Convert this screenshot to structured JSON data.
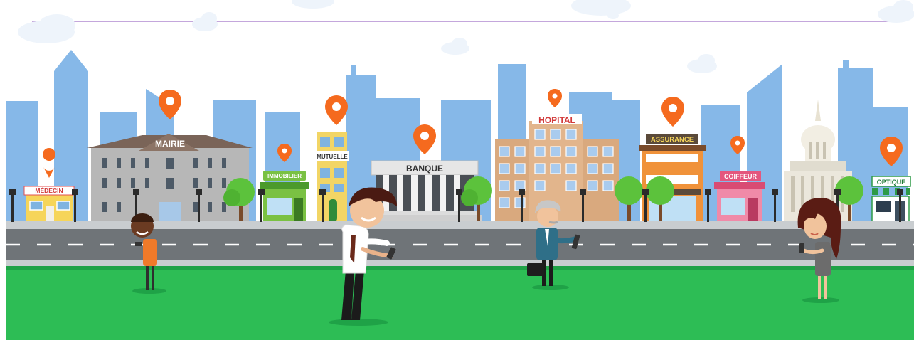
{
  "colors": {
    "sky": "#ffffff",
    "skyline": "#7fb4e6",
    "skyline_dark": "#6aa3dc",
    "grass": "#2dbd55",
    "grass_edge": "#1fa247",
    "road": "#6f7478",
    "sidewalk": "#c9cdd0",
    "pin": "#f56a1e",
    "divider_line": "#b08ad0"
  },
  "buildings": {
    "medecin": "MÉDECIN",
    "mairie": "MAIRIE",
    "immobilier": "IMMOBILIER",
    "mutuelle": "MUTUELLE",
    "banque": "BANQUE",
    "hopital": "HOPITAL",
    "assurance": "ASSURANCE",
    "coiffeur": "COIFFEUR",
    "optique": "OPTIQUE"
  },
  "icons": {
    "pin": "location-pin-icon",
    "cloud": "cloud-icon",
    "tree": "tree-icon",
    "lamp": "street-lamp-icon"
  }
}
